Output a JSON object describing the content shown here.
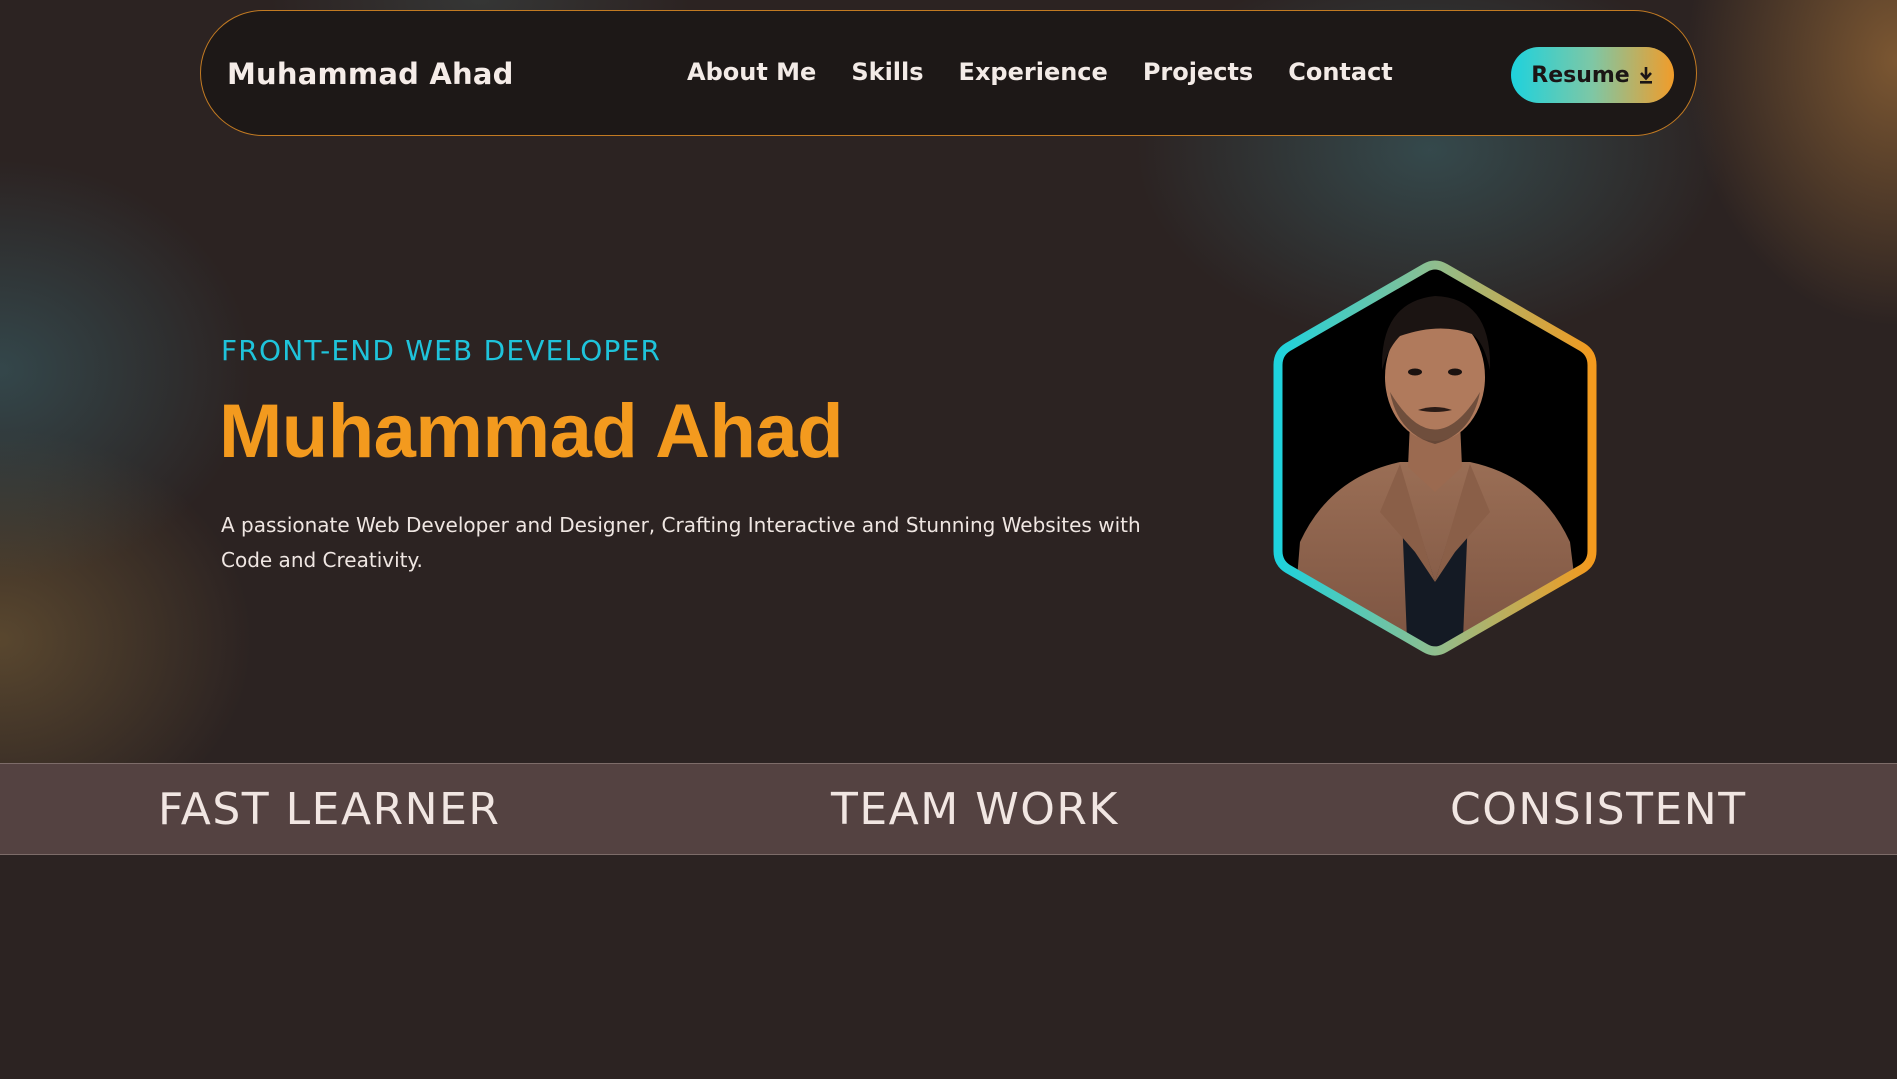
{
  "navbar": {
    "brand": "Muhammad Ahad",
    "links": [
      "About Me",
      "Skills",
      "Experience",
      "Projects",
      "Contact"
    ],
    "resume_label": "Resume",
    "resume_icon": "download-icon"
  },
  "hero": {
    "role": "FRONT-END WEB DEVELOPER",
    "name": "Muhammad Ahad",
    "description": "A passionate Web Developer and Designer, Crafting Interactive and Stunning Websites with Code and Creativity.",
    "avatar_icon": "profile-photo"
  },
  "strip": {
    "items": [
      "FAST LEARNER",
      "TEAM WORK",
      "CONSISTENT"
    ]
  },
  "colors": {
    "accent_orange": "#f39a1e",
    "accent_cyan": "#1fc3da",
    "background": "#2c2322",
    "navbar_bg": "#1d1817",
    "strip_bg": "#544241"
  }
}
